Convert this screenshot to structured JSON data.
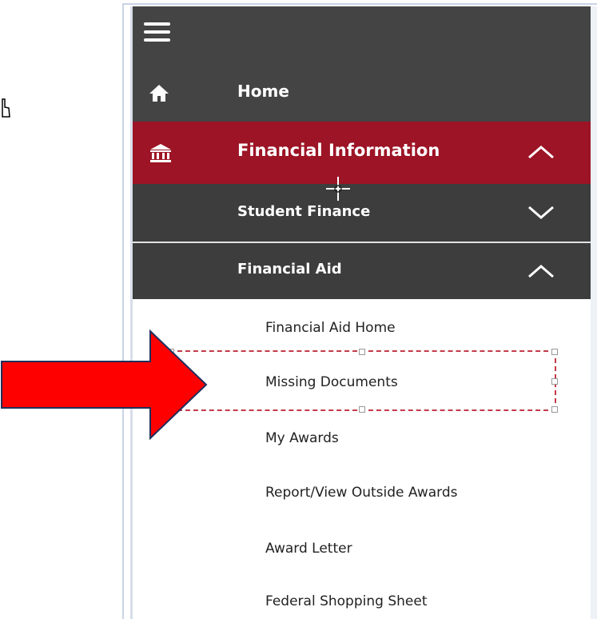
{
  "sidebar": {
    "menu_icon": "hamburger-menu-icon",
    "home": {
      "label": "Home",
      "icon": "home-icon"
    },
    "financial_information": {
      "label": "Financial Information",
      "icon": "bank-building-icon",
      "expanded": true
    },
    "student_finance": {
      "label": "Student Finance",
      "expanded": false
    },
    "financial_aid": {
      "label": "Financial Aid",
      "expanded": true,
      "items": [
        {
          "label": "Financial Aid Home"
        },
        {
          "label": "Missing Documents",
          "highlighted": true
        },
        {
          "label": "My Awards"
        },
        {
          "label": "Report/View Outside Awards"
        },
        {
          "label": "Award Letter"
        },
        {
          "label": "Federal Shopping Sheet"
        }
      ]
    }
  },
  "colors": {
    "nav_dark": "#444444",
    "nav_submenu_dark": "#3d3d3d",
    "active_red": "#9c1425",
    "annotation_arrow": "#ff0000",
    "focus_border": "#c33a4a"
  },
  "annotation": {
    "icon": "red-arrow-icon"
  }
}
